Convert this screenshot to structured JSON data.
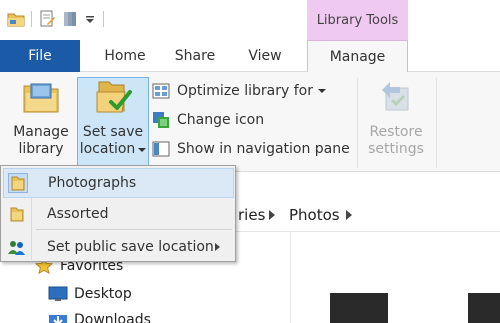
{
  "titlebar": {
    "context_header": "Library Tools",
    "icons": [
      "folder-icon",
      "properties-icon",
      "new-folder-icon",
      "customize-qat-icon"
    ]
  },
  "tabs": [
    {
      "label": "File",
      "active": false
    },
    {
      "label": "Home",
      "active": false
    },
    {
      "label": "Share",
      "active": false
    },
    {
      "label": "View",
      "active": false
    },
    {
      "label": "Manage",
      "active": true
    }
  ],
  "ribbon": {
    "manage_library": {
      "line1": "Manage",
      "line2": "library"
    },
    "set_save_location": {
      "line1": "Set save",
      "line2": "location"
    },
    "optimize_library_for": "Optimize library for",
    "change_icon": "Change icon",
    "show_in_navigation_pane": "Show in navigation pane",
    "restore_settings": {
      "line1": "Restore",
      "line2": "settings"
    }
  },
  "menu": {
    "items": [
      {
        "label": "Photographs",
        "checked": true,
        "icon": "folder-icon"
      },
      {
        "label": "Assorted",
        "checked": false,
        "icon": "folder-icon"
      },
      {
        "label": "Set public save location",
        "icon": "public-folder-icon",
        "has_submenu": true
      }
    ]
  },
  "address": {
    "partial": "ries",
    "current": "Photos"
  },
  "navpane": {
    "items": [
      {
        "label": "Favorites",
        "icon": "star-icon"
      },
      {
        "label": "Desktop",
        "icon": "desktop-icon"
      },
      {
        "label": "Downloads",
        "icon": "downloads-icon"
      }
    ]
  },
  "colors": {
    "file_tab": "#1a5aa6",
    "context_tab": "#f0c9f0",
    "selected_button": "#cde6f7",
    "menu_hover": "#dbe9f7"
  }
}
